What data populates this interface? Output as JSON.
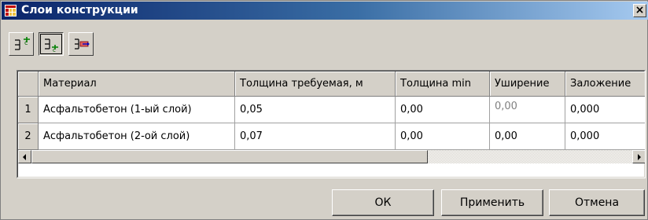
{
  "window": {
    "title": "Слои конструкции",
    "close_label": "×",
    "icon": "grid-table-icon"
  },
  "toolbar": {
    "buttons": [
      {
        "icon": "add-layer-icon",
        "pressed": false
      },
      {
        "icon": "insert-layer-icon",
        "pressed": true
      },
      {
        "icon": "delete-layer-icon",
        "pressed": false
      }
    ]
  },
  "table": {
    "columns": [
      "Материал",
      "Толщина требуемая, м",
      "Толщина min",
      "Уширение",
      "Заложение"
    ],
    "rows": [
      {
        "num": "1",
        "cells": [
          "Асфальтобетон (1-ый слой)",
          "0,05",
          "0,00",
          "0,00",
          "0,000"
        ]
      },
      {
        "num": "2",
        "cells": [
          "Асфальтобетон (2-ой слой)",
          "0,07",
          "0,00",
          "0,00",
          "0,000"
        ]
      }
    ]
  },
  "buttons": {
    "ok": "ОК",
    "apply": "Применить",
    "cancel": "Отмена"
  },
  "colors": {
    "title_start": "#0a246a",
    "title_end": "#a6caf0",
    "face": "#d4d0c8"
  }
}
